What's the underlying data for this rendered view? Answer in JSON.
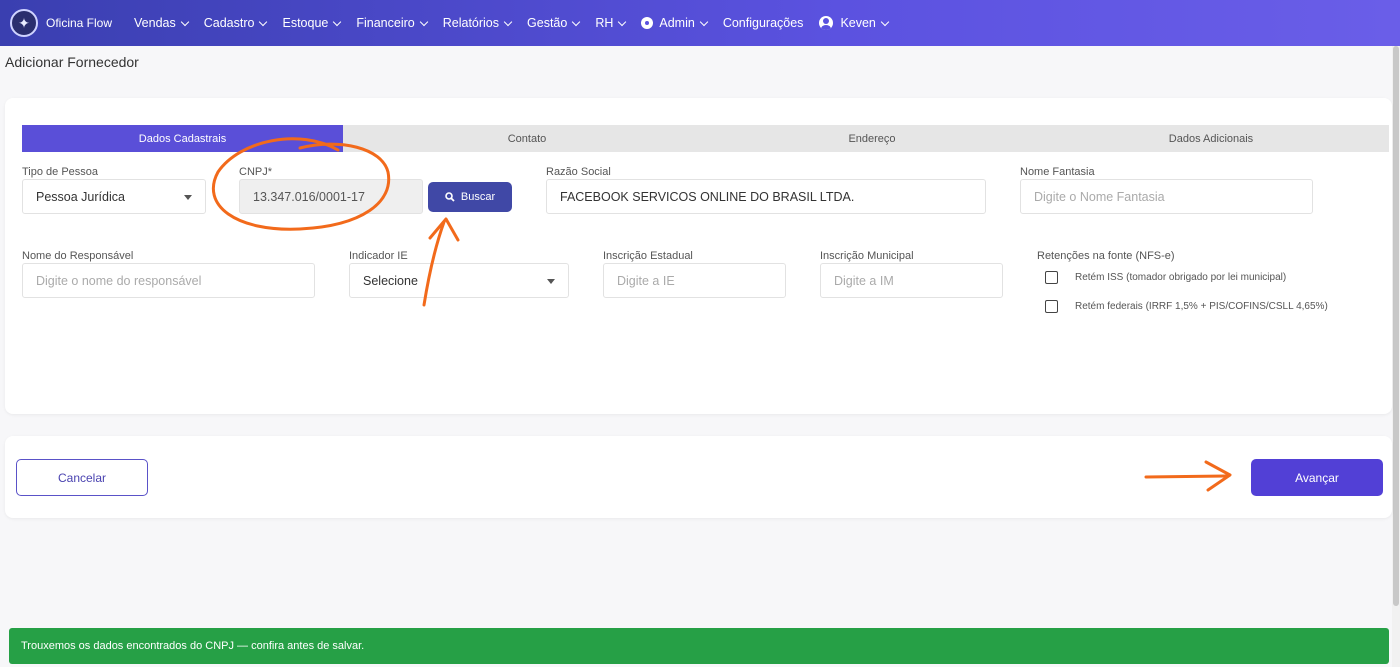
{
  "app": {
    "name": "Oficina Flow"
  },
  "nav": [
    {
      "label": "Vendas",
      "icon": "chevron-down-icon"
    },
    {
      "label": "Cadastro",
      "icon": "chevron-down-icon"
    },
    {
      "label": "Estoque",
      "icon": "chevron-down-icon"
    },
    {
      "label": "Financeiro",
      "icon": "chevron-down-icon"
    },
    {
      "label": "Relatórios",
      "icon": "chevron-down-icon"
    },
    {
      "label": "Gestão",
      "icon": "chevron-down-icon"
    },
    {
      "label": "RH",
      "icon": "chevron-down-icon"
    },
    {
      "label": "Admin",
      "icon": "admin-gear-icon"
    },
    {
      "label": "Configurações"
    },
    {
      "label": "Keven",
      "icon": "user-icon"
    }
  ],
  "page": {
    "title": "Adicionar Fornecedor"
  },
  "tabs": [
    "Dados Cadastrais",
    "Contato",
    "Endereço",
    "Dados Adicionais"
  ],
  "active_tab": "Dados Cadastrais",
  "form": {
    "tipo_pessoa": {
      "label": "Tipo de Pessoa",
      "value": "Pessoa Jurídica"
    },
    "cnpj": {
      "label": "CNPJ*",
      "value": "13.347.016/0001-17"
    },
    "buscar_label": "Buscar",
    "razao_social": {
      "label": "Razão Social",
      "value": "FACEBOOK SERVICOS ONLINE DO BRASIL LTDA."
    },
    "nome_fantasia": {
      "label": "Nome Fantasia",
      "placeholder": "Digite o Nome Fantasia"
    },
    "responsavel": {
      "label": "Nome do Responsável",
      "placeholder": "Digite o nome do responsável"
    },
    "indicador_ie": {
      "label": "Indicador IE",
      "value": "Selecione"
    },
    "inscricao_estadual": {
      "label": "Inscrição Estadual",
      "placeholder": "Digite a IE"
    },
    "inscricao_municipal": {
      "label": "Inscrição Municipal",
      "placeholder": "Digite a IM"
    },
    "retencoes": {
      "label": "Retenções na fonte (NFS-e)",
      "options": [
        {
          "label": "Retém ISS (tomador obrigado por lei municipal)",
          "checked": false
        },
        {
          "label": "Retém federais (IRRF 1,5% + PIS/COFINS/CSLL 4,65%)",
          "checked": false
        }
      ]
    }
  },
  "actions": {
    "cancel": "Cancelar",
    "next": "Avançar"
  },
  "toast": {
    "message": "Trouxemos os dados encontrados do CNPJ — confira antes de salvar."
  },
  "colors": {
    "primary": "#5240d6",
    "toast": "#26a046",
    "annotation": "#f26a1b"
  }
}
